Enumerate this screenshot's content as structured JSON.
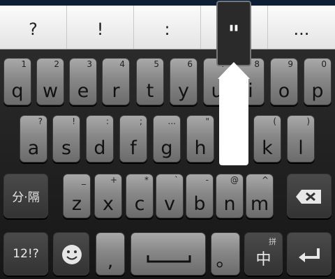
{
  "candidates": [
    "?",
    "!",
    ":",
    "\"",
    "..."
  ],
  "rows": [
    [
      {
        "main": "q",
        "sub": "1"
      },
      {
        "main": "w",
        "sub": "2"
      },
      {
        "main": "e",
        "sub": "3"
      },
      {
        "main": "r",
        "sub": "4"
      },
      {
        "main": "t",
        "sub": "5"
      },
      {
        "main": "y",
        "sub": "6"
      },
      {
        "main": "u",
        "sub": "7"
      },
      {
        "main": "i",
        "sub": "8"
      },
      {
        "main": "o",
        "sub": "9"
      },
      {
        "main": "p",
        "sub": "0"
      }
    ],
    [
      {
        "main": "a",
        "sub": "?"
      },
      {
        "main": "s",
        "sub": "!"
      },
      {
        "main": "d",
        "sub": ":"
      },
      {
        "main": "f",
        "sub": ";"
      },
      {
        "main": "g",
        "sub": "..."
      },
      {
        "main": "h",
        "sub": "\""
      },
      {
        "main": "j",
        "sub": "'"
      },
      {
        "main": "k",
        "sub": "("
      },
      {
        "main": "l",
        "sub": ")"
      }
    ],
    [
      {
        "main": "z",
        "sub": "_"
      },
      {
        "main": "x",
        "sub": "+"
      },
      {
        "main": "c",
        "sub": "*"
      },
      {
        "main": "v",
        "sub": "`"
      },
      {
        "main": "b",
        "sub": "-"
      },
      {
        "main": "n",
        "sub": "@"
      },
      {
        "main": "m",
        "sub": "^"
      }
    ]
  ],
  "special": {
    "split_label": "分·隔",
    "symbols_label": "12!?",
    "emoji_icon": "smiley-icon",
    "comma_label": ",",
    "space_icon": "space-bar-icon",
    "period_label": "。",
    "lang_label": "中",
    "lang_sub": "拼",
    "backspace_icon": "backspace-icon",
    "enter_icon": "enter-icon"
  },
  "popup": {
    "char": "\""
  }
}
